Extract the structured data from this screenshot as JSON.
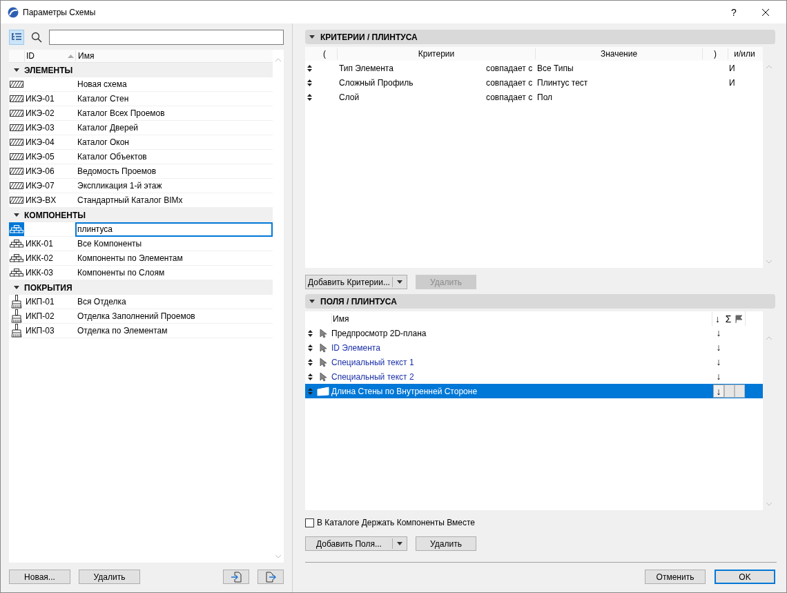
{
  "window": {
    "title": "Параметры Схемы",
    "help": "?"
  },
  "schemes": {
    "columns": [
      "ID",
      "Имя"
    ],
    "groups": [
      {
        "label": "ЭЛЕМЕНТЫ",
        "kind": "elements",
        "expanded": true,
        "rows": [
          {
            "id": "",
            "name": "Новая схема",
            "selected": false
          },
          {
            "id": "ИКЭ-01",
            "name": "Каталог Стен",
            "selected": false
          },
          {
            "id": "ИКЭ-02",
            "name": "Каталог Всех Проемов",
            "selected": false
          },
          {
            "id": "ИКЭ-03",
            "name": "Каталог Дверей",
            "selected": false
          },
          {
            "id": "ИКЭ-04",
            "name": "Каталог Окон",
            "selected": false
          },
          {
            "id": "ИКЭ-05",
            "name": "Каталог Объектов",
            "selected": false
          },
          {
            "id": "ИКЭ-06",
            "name": "Ведомость Проемов",
            "selected": false
          },
          {
            "id": "ИКЭ-07",
            "name": "Экспликация 1-й этаж",
            "selected": false
          },
          {
            "id": "ИКЭ-BX",
            "name": "Стандартный Каталог BIMx",
            "selected": false
          }
        ]
      },
      {
        "label": "КОМПОНЕНТЫ",
        "kind": "components",
        "expanded": true,
        "rows": [
          {
            "id": "",
            "name": "плинтуса",
            "selected": true
          },
          {
            "id": "ИКК-01",
            "name": "Все Компоненты",
            "selected": false
          },
          {
            "id": "ИКК-02",
            "name": "Компоненты по Элементам",
            "selected": false
          },
          {
            "id": "ИКК-03",
            "name": "Компоненты по Слоям",
            "selected": false
          }
        ]
      },
      {
        "label": "ПОКРЫТИЯ",
        "kind": "surfaces",
        "expanded": true,
        "rows": [
          {
            "id": "ИКП-01",
            "name": "Вся Отделка",
            "selected": false
          },
          {
            "id": "ИКП-02",
            "name": "Отделка Заполнений Проемов",
            "selected": false
          },
          {
            "id": "ИКП-03",
            "name": "Отделка по Элементам",
            "selected": false
          }
        ]
      }
    ],
    "buttons": {
      "new": "Новая...",
      "delete": "Удалить"
    }
  },
  "criteria": {
    "title": "КРИТЕРИИ /  ПЛИНТУСА",
    "expanded": true,
    "columns": [
      "(",
      "Критерии",
      "Значение",
      ")",
      "и/или"
    ],
    "rows": [
      {
        "criterion": "Тип Элемента",
        "operator": "совпадает с",
        "value": "Все Типы",
        "logic": "И"
      },
      {
        "criterion": "Сложный Профиль",
        "operator": "совпадает с",
        "value": "Плинтус тест",
        "logic": "И"
      },
      {
        "criterion": "Слой",
        "operator": "совпадает с",
        "value": "Пол"
      }
    ],
    "add_button": "Добавить Критерии...",
    "delete_button": {
      "label": "Удалить",
      "disabled": true
    }
  },
  "fields": {
    "title": "ПОЛЯ /  ПЛИНТУСА",
    "expanded": true,
    "columns": {
      "name": "Имя",
      "sort": "↓",
      "sum": "Σ"
    },
    "rows": [
      {
        "name": "Предпросмотр 2D-плана",
        "kind": "general",
        "sort": "↓",
        "selected": false
      },
      {
        "name": "ID Элемента",
        "kind": "property",
        "sort": "↓",
        "selected": false
      },
      {
        "name": "Специальный текст  1",
        "kind": "property",
        "sort": "↓",
        "selected": false
      },
      {
        "name": "Специальный текст  2",
        "kind": "property",
        "sort": "↓",
        "selected": false
      },
      {
        "name": "Длина Стены по Внутренней Стороне",
        "kind": "wall",
        "sort": "↓",
        "selected": true
      }
    ],
    "keep_together": {
      "label": "В Каталоге Держать Компоненты Вместе",
      "checked": false
    },
    "add_button": "Добавить Поля...",
    "delete_button": {
      "label": "Удалить",
      "disabled": false
    }
  },
  "footer": {
    "cancel": "Отменить",
    "ok": "OK"
  }
}
